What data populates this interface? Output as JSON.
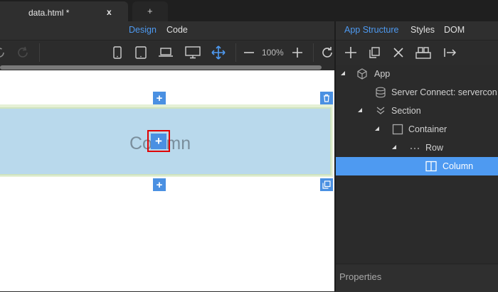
{
  "tabs": [
    {
      "label": "data.html *",
      "close": "x"
    },
    {
      "label": "+"
    }
  ],
  "view_toggle": {
    "design": "Design",
    "code": "Code",
    "active": "design"
  },
  "toolbar": {
    "zoom_level": "100%",
    "icons": [
      "undo-icon",
      "redo-icon",
      "phone-icon",
      "tablet-icon",
      "laptop-icon",
      "desktop-icon",
      "move-icon",
      "zoom-out-icon",
      "zoom-in-icon",
      "refresh-icon"
    ]
  },
  "canvas": {
    "column_label": "Column"
  },
  "right_panel": {
    "tabs": [
      {
        "label": "App Structure",
        "active": true
      },
      {
        "label": "Styles",
        "active": false
      },
      {
        "label": "DOM",
        "active": false
      }
    ],
    "tree": [
      {
        "label": "App",
        "icon": "cube-icon",
        "level": 0,
        "expanded": true
      },
      {
        "label": "Server Connect: servercon",
        "icon": "database-icon",
        "level": 1
      },
      {
        "label": "Section",
        "icon": "double-chevron-icon",
        "level": 1,
        "expanded": true
      },
      {
        "label": "Container",
        "icon": "square-icon",
        "level": 2,
        "expanded": true
      },
      {
        "label": "Row",
        "icon": "dots-icon",
        "level": 3,
        "expanded": true
      },
      {
        "label": "Column",
        "icon": "column-icon",
        "level": 4,
        "selected": true
      }
    ],
    "properties_label": "Properties"
  },
  "colors": {
    "accent": "#4e9af1",
    "add_button": "#4a90e2",
    "highlight_border": "#e00000",
    "column_fill": "#b9d9ec"
  }
}
